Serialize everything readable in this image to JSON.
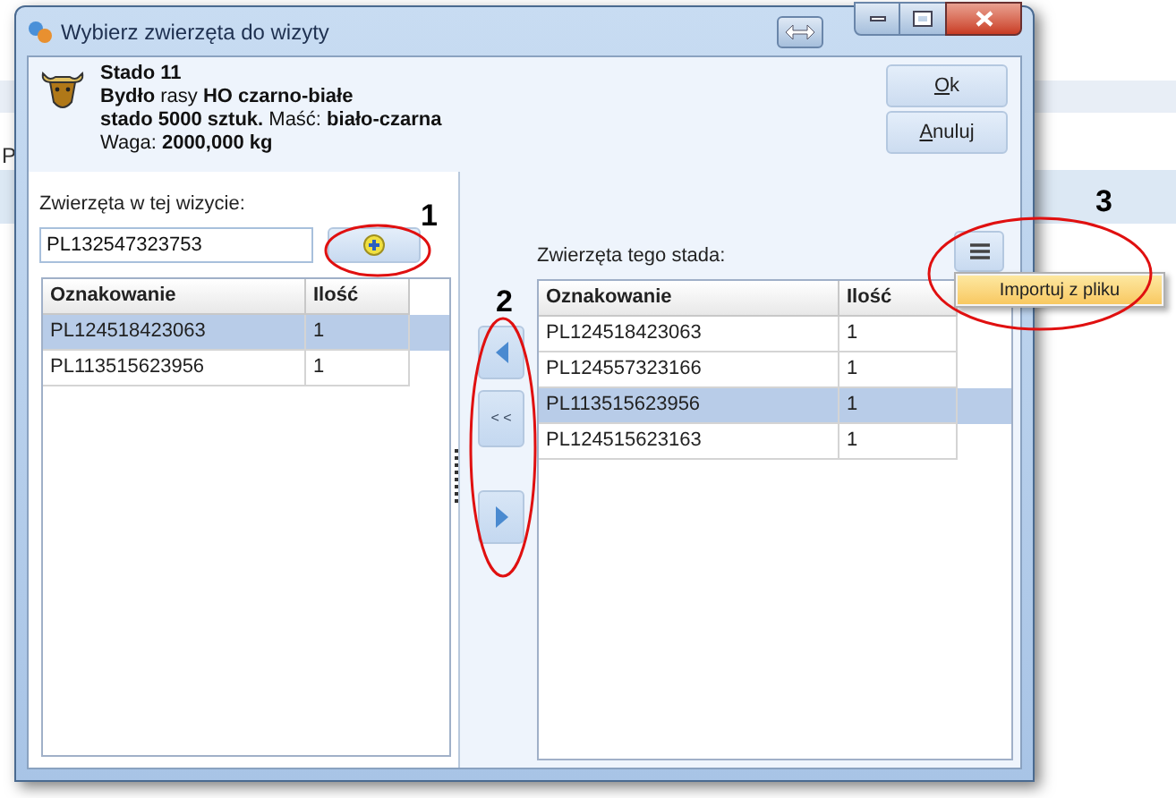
{
  "background": {
    "fragment": "P"
  },
  "window": {
    "title": "Wybierz zwierzęta do wizyty"
  },
  "herd": {
    "name": "Stado 11",
    "line_2": "**Bydło** rasy **HO czarno-białe**",
    "line_3": "**stado 5000 sztuk.** Maść: **biało-czarna**",
    "line_4": "Waga: **2000,000 kg**"
  },
  "buttons": [
    {
      "label": "Ok"
    },
    {
      "label": "Anuluj"
    }
  ],
  "visit_animals": {
    "label": "Zwierzęta w tej wizycie:",
    "input": {
      "value": "PL132547323753"
    },
    "columns": [
      "Oznakowanie",
      "Ilość"
    ],
    "rows": [
      {
        "cells": [
          "PL124518423063",
          "1"
        ],
        "selected": true
      },
      {
        "cells": [
          "PL113515623956",
          "1"
        ],
        "selected": false
      }
    ]
  },
  "transfer_buttons": [
    {
      "kind": "arrow-left"
    },
    {
      "kind": "text",
      "label": "< <"
    },
    {
      "kind": "arrow-right"
    }
  ],
  "herd_animals": {
    "label": "Zwierzęta tego stada:",
    "columns": [
      "Oznakowanie",
      "Ilość"
    ],
    "rows": [
      {
        "cells": [
          "PL124518423063",
          "1"
        ],
        "selected": false
      },
      {
        "cells": [
          "PL124557323166",
          "1"
        ],
        "selected": false
      },
      {
        "cells": [
          "PL113515623956",
          "1"
        ],
        "selected": true
      },
      {
        "cells": [
          "PL124515623163",
          "1"
        ],
        "selected": false
      }
    ]
  },
  "menu": {
    "open": true,
    "items": [
      {
        "label": "Importuj z pliku",
        "selected": true
      }
    ]
  },
  "annotations": [
    {
      "label": "1"
    },
    {
      "label": "2"
    },
    {
      "label": "3"
    }
  ]
}
